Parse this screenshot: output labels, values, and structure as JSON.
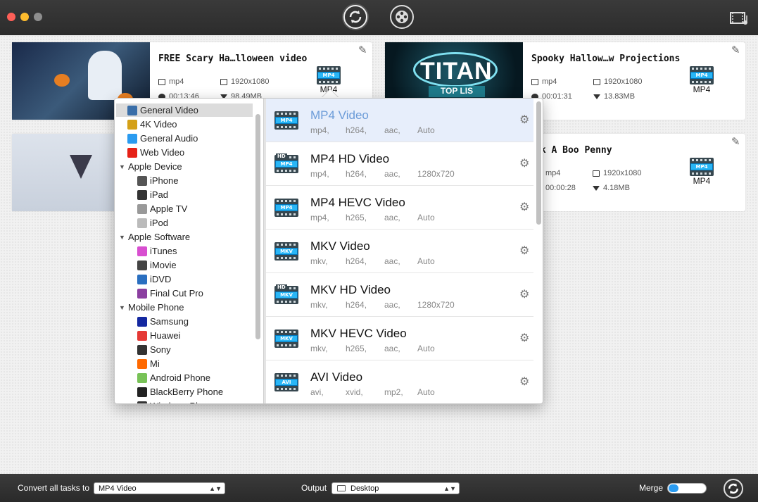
{
  "titlebar": {
    "convert_icon": "convert-icon",
    "toolbox_icon": "toolbox-icon",
    "media_icon": "media-browser-icon"
  },
  "tasks": [
    {
      "title": "FREE Scary Ha…lloween video",
      "container": "mp4",
      "resolution": "1920x1080",
      "duration": "00:13:46",
      "size": "98.49MB",
      "format": "MP4"
    },
    {
      "title": "Spooky Hallow…w Projections",
      "container": "mp4",
      "resolution": "1920x1080",
      "duration": "00:01:31",
      "size": "13.83MB",
      "format": "MP4",
      "thumb_text": "TITAN",
      "thumb_sub": "TOP LIS"
    },
    {
      "title": "ek A Boo Penny",
      "container": "mp4",
      "resolution": "1920x1080",
      "duration": "00:00:28",
      "size": "4.18MB",
      "format": "MP4"
    }
  ],
  "categories": [
    {
      "label": "General Video",
      "selected": true,
      "indent": 0,
      "icon": "film-icon"
    },
    {
      "label": "4K Video",
      "indent": 0,
      "icon": "4k-icon"
    },
    {
      "label": "General Audio",
      "indent": 0,
      "icon": "music-note-icon"
    },
    {
      "label": "Web Video",
      "indent": 0,
      "icon": "youtube-icon"
    },
    {
      "label": "Apple Device",
      "indent": 0,
      "group": true
    },
    {
      "label": "iPhone",
      "indent": 1,
      "icon": "iphone-icon"
    },
    {
      "label": "iPad",
      "indent": 1,
      "icon": "ipad-icon"
    },
    {
      "label": "Apple TV",
      "indent": 1,
      "icon": "appletv-icon"
    },
    {
      "label": "iPod",
      "indent": 1,
      "icon": "ipod-icon"
    },
    {
      "label": "Apple Software",
      "indent": 0,
      "group": true
    },
    {
      "label": "iTunes",
      "indent": 1,
      "icon": "itunes-icon"
    },
    {
      "label": "iMovie",
      "indent": 1,
      "icon": "imovie-icon"
    },
    {
      "label": "iDVD",
      "indent": 1,
      "icon": "idvd-icon"
    },
    {
      "label": "Final Cut Pro",
      "indent": 1,
      "icon": "final-cut-pro-icon"
    },
    {
      "label": "Mobile Phone",
      "indent": 0,
      "group": true
    },
    {
      "label": "Samsung",
      "indent": 1,
      "icon": "samsung-icon"
    },
    {
      "label": "Huawei",
      "indent": 1,
      "icon": "huawei-icon"
    },
    {
      "label": "Sony",
      "indent": 1,
      "icon": "sony-icon"
    },
    {
      "label": "Mi",
      "indent": 1,
      "icon": "mi-icon"
    },
    {
      "label": "Android Phone",
      "indent": 1,
      "icon": "android-icon"
    },
    {
      "label": "BlackBerry Phone",
      "indent": 1,
      "icon": "blackberry-icon"
    },
    {
      "label": "Windows Phone",
      "indent": 1,
      "icon": "windows-phone-icon"
    }
  ],
  "formats": [
    {
      "name": "MP4 Video",
      "specs": [
        "mp4,",
        "h264,",
        "aac,",
        "Auto"
      ],
      "badge": "MP4",
      "selected": true
    },
    {
      "name": "MP4 HD Video",
      "specs": [
        "mp4,",
        "h264,",
        "aac,",
        "1280x720"
      ],
      "badge": "MP4",
      "hd": true
    },
    {
      "name": "MP4 HEVC Video",
      "specs": [
        "mp4,",
        "h265,",
        "aac,",
        "Auto"
      ],
      "badge": "MP4"
    },
    {
      "name": "MKV Video",
      "specs": [
        "mkv,",
        "h264,",
        "aac,",
        "Auto"
      ],
      "badge": "MKV"
    },
    {
      "name": "MKV HD Video",
      "specs": [
        "mkv,",
        "h264,",
        "aac,",
        "1280x720"
      ],
      "badge": "MKV",
      "hd": true
    },
    {
      "name": "MKV HEVC Video",
      "specs": [
        "mkv,",
        "h265,",
        "aac,",
        "Auto"
      ],
      "badge": "MKV"
    },
    {
      "name": "AVI Video",
      "specs": [
        "avi,",
        "xvid,",
        "mp2,",
        "Auto"
      ],
      "badge": "AVI"
    }
  ],
  "bottom": {
    "convert_all_label": "Convert all tasks to",
    "convert_all_value": "MP4 Video",
    "output_label": "Output",
    "output_value": "Desktop",
    "merge_label": "Merge"
  },
  "colors": {
    "accent": "#2a9bf0",
    "selected_format_text": "#6b9bd8"
  }
}
